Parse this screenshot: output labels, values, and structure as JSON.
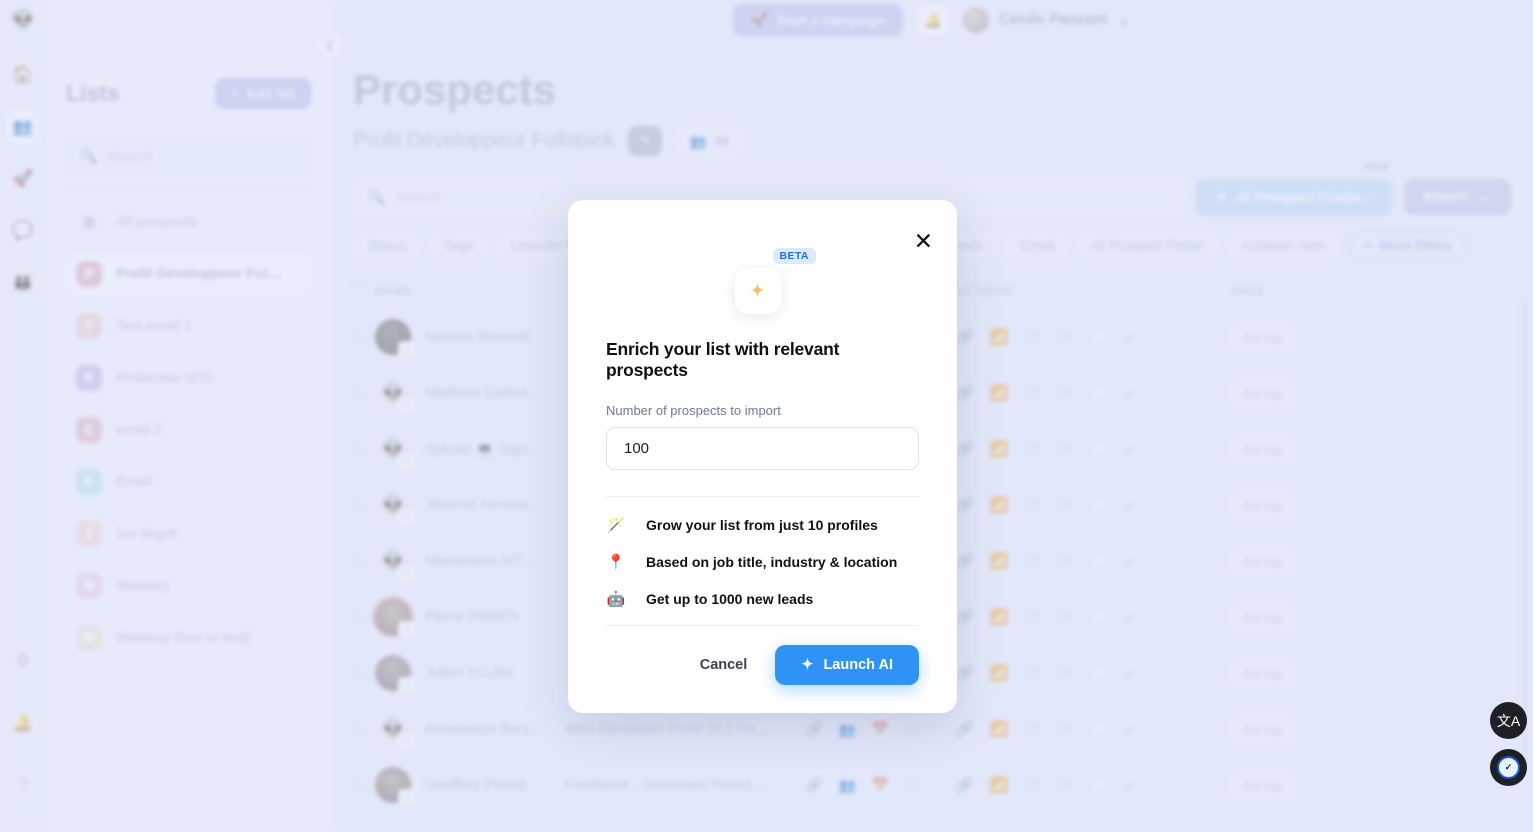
{
  "nav_rail": {
    "logo_icon": "alien-logo-icon",
    "top_items": [
      {
        "name": "home",
        "icon": "🏠"
      },
      {
        "name": "prospects",
        "icon": "👥"
      },
      {
        "name": "campaigns",
        "icon": "🚀"
      },
      {
        "name": "inbox",
        "icon": "💬"
      },
      {
        "name": "team",
        "icon": "👪"
      }
    ],
    "bottom_items": [
      {
        "name": "settings",
        "icon": "⚙"
      },
      {
        "name": "notifications",
        "icon": "🔔"
      },
      {
        "name": "help",
        "icon": "?"
      }
    ]
  },
  "sidebar": {
    "title": "Lists",
    "add_list_label": "Add list",
    "search_placeholder": "Search",
    "all_prospects_label": "All prospects",
    "items": [
      {
        "label": "Profil Développeur Ful...",
        "initial": "P",
        "color": "#e39ab4",
        "selected": true
      },
      {
        "label": "Test email 1",
        "initial": "T",
        "color": "#ecbcc4",
        "selected": false
      },
      {
        "label": "Rédacteur sEO",
        "initial": "R",
        "color": "#b1a8ef",
        "selected": false
      },
      {
        "label": "email 2",
        "initial": "E",
        "color": "#e2a0bb",
        "selected": false
      },
      {
        "label": "Email",
        "initial": "E",
        "color": "#97dce4",
        "selected": false
      },
      {
        "label": "1er degré",
        "initial": "1",
        "color": "#f3c3cf",
        "selected": false
      },
      {
        "label": "Waalaxy",
        "initial": "W",
        "color": "#e8bcd8",
        "selected": false
      },
      {
        "label": "Waalaxy (free to test)",
        "initial": "W",
        "color": "#dcd6c4",
        "selected": false
      }
    ]
  },
  "topbar": {
    "campaign_label": "Start a campaign",
    "user_name": "Cécile Panzani"
  },
  "header": {
    "title": "Prospects",
    "subtitle": "Profil Développeur Fullstack",
    "count": "48"
  },
  "toolbar": {
    "search_placeholder": "Search",
    "ai_finder_label": "AI Prospect Finder...",
    "new_badge": "NEW",
    "import_label": "Import"
  },
  "filters": [
    "Status",
    "Tags",
    "LinkedIn V",
    "ests",
    "Email",
    "AI Prospect Finder",
    "Invitation sent"
  ],
  "more_filters_label": "More filters",
  "table": {
    "columns": [
      "NAME",
      "ACTIONS",
      "TAGS"
    ],
    "no_tag_label": "No tag",
    "rows": [
      {
        "name": "Nicolas Simonet",
        "avatar": "photo1",
        "job": "",
        "tag": "No tag"
      },
      {
        "name": "Matthieu Dalma...",
        "avatar": "alien",
        "job": "",
        "tag": "No tag"
      },
      {
        "name": "Sylvain 💻 Sigo...",
        "avatar": "alien",
        "job": "",
        "tag": "No tag"
      },
      {
        "name": "Jérémie Keroua...",
        "avatar": "alien",
        "job": "",
        "tag": "No tag"
      },
      {
        "name": "Massinissa AIT ...",
        "avatar": "alien",
        "job": "",
        "tag": "No tag"
      },
      {
        "name": "Pierre FABIEN",
        "avatar": "photo2",
        "job": "",
        "tag": "No tag"
      },
      {
        "name": "Julien YLLAN",
        "avatar": "photo3",
        "job": "",
        "tag": "No tag"
      },
      {
        "name": "Anastasiya Bary...",
        "avatar": "alien",
        "job": "Web Developer Front JS | Ful...",
        "tag": "No tag"
      },
      {
        "name": "Geoffrey Picard",
        "avatar": "photo4",
        "job": "Freelance - Developer React ...",
        "tag": "No tag"
      }
    ]
  },
  "modal": {
    "badge": "BETA",
    "title": "Enrich your list with relevant prospects",
    "field_label": "Number of prospects to import",
    "field_value": "100",
    "features": [
      {
        "icon": "🪄",
        "text": "Grow your list from just 10 profiles"
      },
      {
        "icon": "📍",
        "text": "Based on job title, industry & location"
      },
      {
        "icon": "🤖",
        "text": "Get up to 1000 new leads"
      }
    ],
    "cancel_label": "Cancel",
    "launch_label": "Launch AI"
  },
  "colors": {
    "accent_blue": "#2f93f5",
    "beta_blue": "#1f6fe8",
    "page_bg": "#e3e7fa"
  }
}
